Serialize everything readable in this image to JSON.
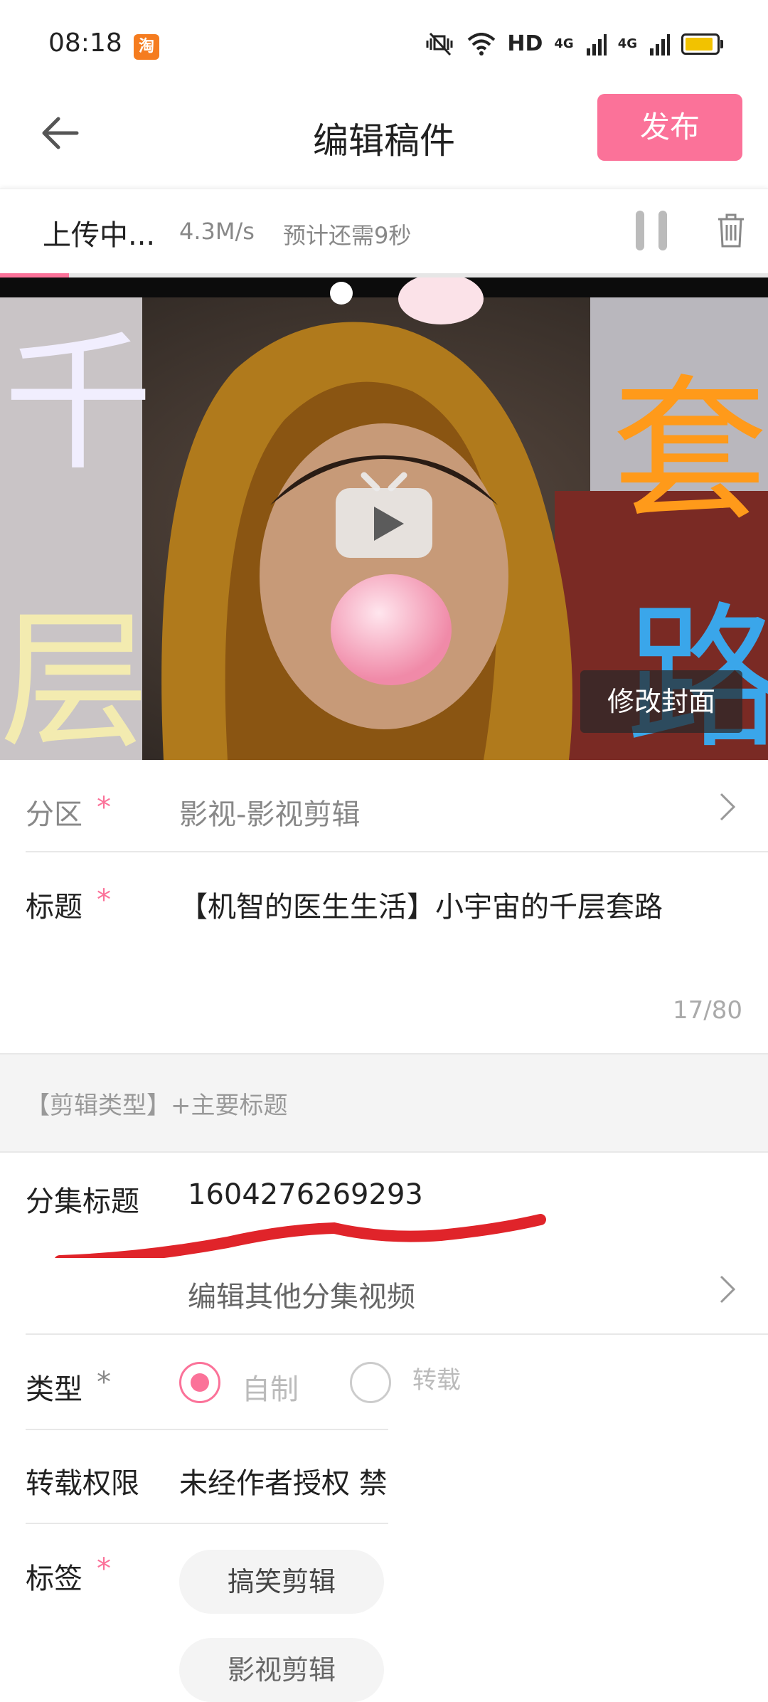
{
  "status_bar": {
    "time": "08:18",
    "app_badge": "淘",
    "network_labels": [
      "HD",
      "4G",
      "4G"
    ]
  },
  "header": {
    "title": "编辑稿件",
    "publish_label": "发布"
  },
  "upload": {
    "status": "上传中...",
    "speed": "4.3M/s",
    "eta": "预计还需9秒",
    "progress_fraction": 0.09
  },
  "cover": {
    "text_left": [
      "千",
      "层"
    ],
    "text_right": [
      "套",
      "路"
    ],
    "change_cover_label": "修改封面"
  },
  "form": {
    "partition": {
      "label": "分区",
      "required": "*",
      "value": "影视-影视剪辑"
    },
    "title": {
      "label": "标题",
      "required": "*",
      "value": "【机智的医生生活】小宇宙的千层套路",
      "counter": "17/80"
    },
    "title_hint": "【剪辑类型】+主要标题",
    "episode": {
      "label": "分集标题",
      "value": "1604276269293",
      "edit_others": "编辑其他分集视频"
    },
    "type": {
      "label": "类型",
      "required": "*",
      "options": [
        "自制",
        "转载"
      ],
      "selected": "自制"
    },
    "repost": {
      "label": "转载权限",
      "value": "未经作者授权 禁"
    },
    "tags": {
      "label": "标签",
      "required": "*",
      "items": [
        "搞笑剪辑",
        "影视剪辑"
      ]
    }
  },
  "colors": {
    "accent": "#fb7299",
    "annotation_scribble": "#e0242a"
  }
}
